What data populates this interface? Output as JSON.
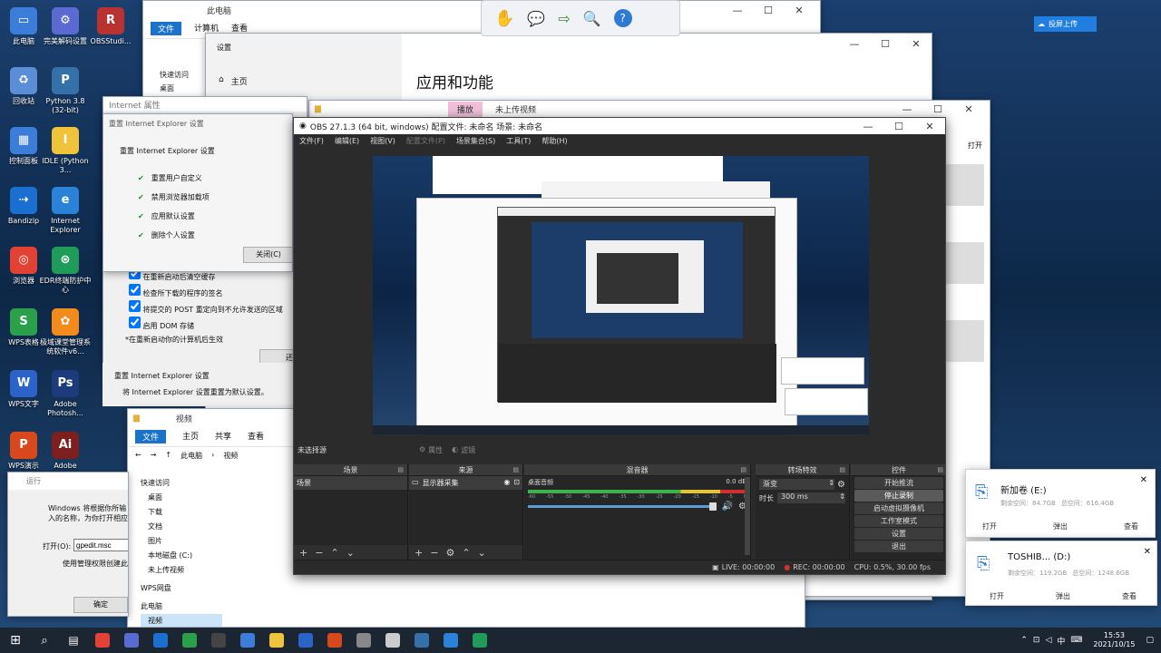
{
  "desktop_icons": [
    {
      "label": "此电脑",
      "icon": "computer-icon"
    },
    {
      "label": "完美解码设置",
      "icon": "gear-icon"
    },
    {
      "label": "OBSStudi...",
      "icon": "rar-icon"
    },
    {
      "label": "回收站",
      "icon": "recycle-bin-icon"
    },
    {
      "label": "Python 3.8 (32-bit)",
      "icon": "python-icon"
    },
    {
      "label": "控制面板",
      "icon": "control-panel-icon"
    },
    {
      "label": "IDLE (Python 3...",
      "icon": "idle-icon"
    },
    {
      "label": "Bandizip",
      "icon": "bandizip-icon"
    },
    {
      "label": "Internet Explorer",
      "icon": "ie-icon"
    },
    {
      "label": "浏览器",
      "icon": "chrome-icon"
    },
    {
      "label": "EDR终端防护中心",
      "icon": "edr-icon"
    },
    {
      "label": "WPS表格",
      "icon": "wps-sheet-icon"
    },
    {
      "label": "极域课堂管理系统软件v6...",
      "icon": "classroom-icon"
    },
    {
      "label": "WPS文字",
      "icon": "wps-writer-icon"
    },
    {
      "label": "Adobe Photosh...",
      "icon": "photoshop-icon"
    },
    {
      "label": "WPS演示",
      "icon": "wps-present-icon"
    },
    {
      "label": "Adobe",
      "icon": "illustrator-icon"
    }
  ],
  "explorer_back": {
    "title": "此电脑",
    "tabs": [
      "文件",
      "计算机",
      "查看"
    ],
    "nav": [
      "快速访问",
      "桌面"
    ]
  },
  "settings_window": {
    "address": "设置",
    "home": "主页",
    "heading": "应用和功能"
  },
  "ie_reset_dialog": {
    "outer_title": "Internet 属性",
    "title": "重置 Internet Explorer 设置",
    "heading": "重置 Internet Explorer 设置",
    "items": [
      "重置用户自定义",
      "禁用浏览器加载项",
      "应用默认设置",
      "删除个人设置"
    ],
    "close_button": "关闭(C)",
    "options": [
      "在重新启动后清空缓存",
      "检查所下载的程序的签名",
      "将提交的 POST 重定向到不允许发送的区域",
      "启用 DOM 存储"
    ],
    "restart_note": "*在重新启动你的计算机后生效",
    "reset_section": "重置 Internet Explorer 设置",
    "reset_desc": "将 Internet Explorer 设置重置为默认设置。",
    "reset_button": "还"
  },
  "explorer_video": {
    "title": "视频",
    "tabs": [
      "文件",
      "主页",
      "共享",
      "查看"
    ],
    "path": [
      "此电脑",
      "视频"
    ],
    "nav": [
      "快速访问",
      "桌面",
      "下载",
      "文档",
      "图片",
      "本地磁盘 (C:)",
      "未上传视频",
      "WPS网盘",
      "此电脑",
      "视频"
    ]
  },
  "run_dialog": {
    "title": "运行",
    "desc": "Windows 将根据你所输入的名称，为你打开相应的程序、文件夹、文档或 Internet 资源。",
    "open_label": "打开(O):",
    "open_value": "gpedit.msc",
    "admin_note": "使用管理权限创建此任务。",
    "ok_button": "确定"
  },
  "folder_window": {
    "tab": "播放",
    "title": "未上传视频",
    "open": "打开"
  },
  "toolbar_top": {
    "icons": [
      "hand-icon",
      "comment-icon",
      "export-icon",
      "zoom-icon",
      "help-icon"
    ]
  },
  "cloud_button": "投屏上传",
  "obs": {
    "title": "OBS 27.1.3 (64 bit, windows)  配置文件: 未命名  场景: 未命名",
    "menu": [
      "文件(F)",
      "编辑(E)",
      "视图(V)",
      "配置文件(P)",
      "场景集合(S)",
      "工具(T)",
      "帮助(H)"
    ],
    "source_bar": {
      "label": "未选择源",
      "properties": "属性",
      "filters": "滤镜"
    },
    "scenes": {
      "title": "场景",
      "items": [
        "场景"
      ]
    },
    "sources": {
      "title": "来源",
      "items": [
        "显示器采集"
      ]
    },
    "mixer": {
      "title": "混音器",
      "track": "桌面音频",
      "db": "0.0 dB",
      "ticks": [
        "-60",
        "-55",
        "-50",
        "-45",
        "-40",
        "-35",
        "-30",
        "-25",
        "-20",
        "-15",
        "-10",
        "-5",
        "0"
      ]
    },
    "transitions": {
      "title": "转场特效",
      "type": "渐变",
      "duration_label": "时长",
      "duration": "300 ms"
    },
    "controls": {
      "title": "控件",
      "buttons": [
        "开始推流",
        "停止录制",
        "启动虚拟摄像机",
        "工作室模式",
        "设置",
        "退出"
      ]
    },
    "status": {
      "live": "LIVE: 00:00:00",
      "rec": "REC: 00:00:00",
      "cpu": "CPU: 0.5%, 30.00 fps"
    }
  },
  "usb_e": {
    "name": "新加卷 (E:)",
    "used": "剩余空间：84.7GB",
    "total": "总空间：616.4GB",
    "actions": [
      "打开",
      "弹出",
      "查看"
    ]
  },
  "usb_d": {
    "name": "TOSHIB...  (D:)",
    "used": "剩余空间：119.2GB",
    "total": "总空间：1248.6GB",
    "actions": [
      "打开",
      "弹出",
      "查看"
    ]
  },
  "taskbar": {
    "apps": [
      "chrome-icon",
      "vmware-icon",
      "bandizip-icon",
      "wps-sheet-icon",
      "obs-icon",
      "pinned-icon",
      "folder-icon",
      "wps-writer-icon",
      "wps-icon",
      "gear-icon",
      "file-icon",
      "media-icon",
      "photo-icon",
      "app-icon"
    ],
    "ime": "中",
    "time": "15:53",
    "date": "2021/10/15"
  },
  "colors": {
    "obs_bg": "#2b2b2b",
    "accent": "#1a73c9",
    "rec_red": "#d32f2f",
    "meter_green": "#3cb44b"
  }
}
